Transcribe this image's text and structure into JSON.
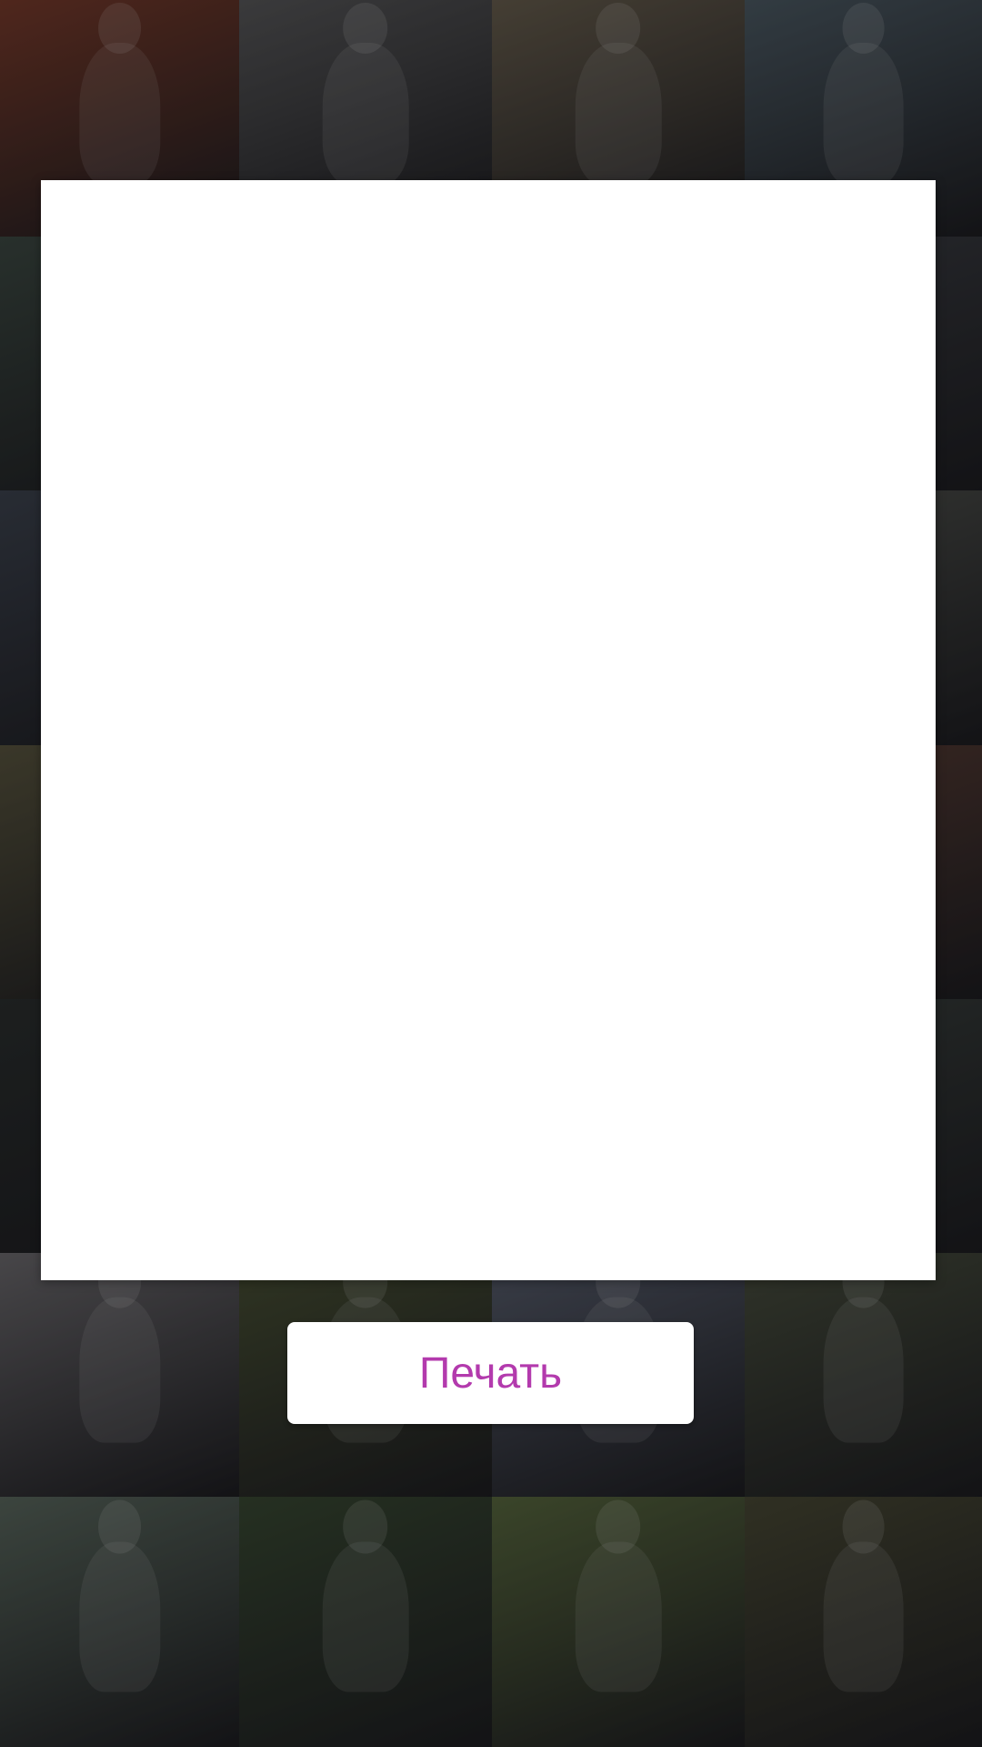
{
  "background": {
    "photos": [
      {
        "name": "photo-woman-smiling",
        "color": "#7a3c2c"
      },
      {
        "name": "photo-man-on-stairs",
        "color": "#5a5a5c"
      },
      {
        "name": "photo-woman-on-rock-city",
        "color": "#6a6050"
      },
      {
        "name": "photo-woman-city-towers",
        "color": "#4e5c66"
      },
      {
        "name": "photo-landscape-left",
        "color": "#3e4a44"
      },
      {
        "name": "photo-center-hidden-1",
        "color": "#3a3a3a"
      },
      {
        "name": "photo-center-hidden-2",
        "color": "#3a3a3a"
      },
      {
        "name": "photo-man-sitting-right",
        "color": "#3c3e44"
      },
      {
        "name": "photo-yellow-car-left",
        "color": "#3e4450"
      },
      {
        "name": "photo-center-hidden-3",
        "color": "#3a3a3a"
      },
      {
        "name": "photo-center-hidden-4",
        "color": "#3a3a3a"
      },
      {
        "name": "photo-yacht-right",
        "color": "#50524e"
      },
      {
        "name": "photo-wheat-field-left",
        "color": "#5a5640"
      },
      {
        "name": "photo-center-hidden-5",
        "color": "#3a3a3a"
      },
      {
        "name": "photo-center-hidden-6",
        "color": "#3a3a3a"
      },
      {
        "name": "photo-woman-hair-right",
        "color": "#5a3e36"
      },
      {
        "name": "photo-dark-left",
        "color": "#2c3030"
      },
      {
        "name": "photo-center-hidden-7",
        "color": "#3a3a3a"
      },
      {
        "name": "photo-center-hidden-8",
        "color": "#3a3a3a"
      },
      {
        "name": "photo-dark-right",
        "color": "#3a403e"
      },
      {
        "name": "photo-woman-glasses-phone",
        "color": "#6e6c70"
      },
      {
        "name": "photo-people-lighthouse",
        "color": "#4a5236"
      },
      {
        "name": "photo-couple-building",
        "color": "#5a6070"
      },
      {
        "name": "photo-girl-white-blouse",
        "color": "#4a5040"
      },
      {
        "name": "photo-couple-kissing-lake",
        "color": "#5c6a60"
      },
      {
        "name": "photo-woman-hedge",
        "color": "#3a4a34"
      },
      {
        "name": "photo-twin-girls-caps",
        "color": "#5a6a40"
      },
      {
        "name": "photo-girl-forest",
        "color": "#4a4a36"
      }
    ]
  },
  "print_button": {
    "label": "Печать",
    "color": "#b33aad"
  }
}
